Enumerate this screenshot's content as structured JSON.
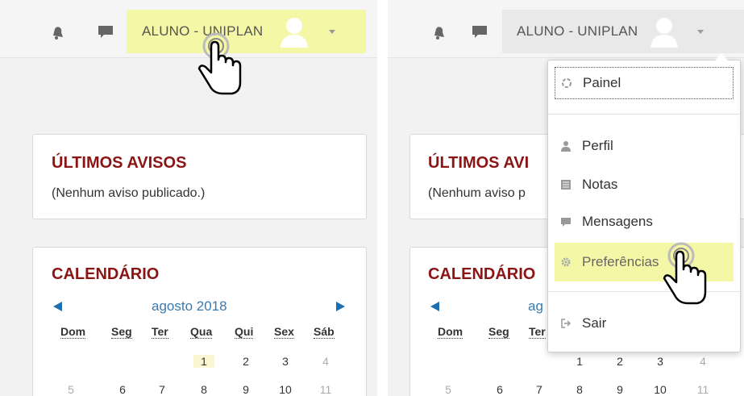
{
  "left": {
    "navbar": {
      "user_name": "ALUNO - UNIPLAN",
      "notification_icon": "bell-icon",
      "messages_icon": "speech-bubble-icon"
    },
    "notices": {
      "title": "ÚLTIMOS AVISOS",
      "text": "(Nenhum aviso publicado.)"
    },
    "calendar": {
      "title": "CALENDÁRIO",
      "month": "agosto 2018",
      "weekdays": [
        "Dom",
        "Seg",
        "Ter",
        "Qua",
        "Qui",
        "Sex",
        "Sáb"
      ],
      "row1": [
        "1",
        "2",
        "3",
        "4"
      ],
      "row2": [
        "5",
        "6",
        "7",
        "8",
        "9",
        "10",
        "11"
      ]
    }
  },
  "right": {
    "navbar": {
      "user_name": "ALUNO - UNIPLAN"
    },
    "notices": {
      "title": "ÚLTIMOS AVI",
      "text": "(Nenhum aviso p"
    },
    "calendar": {
      "title": "CALENDÁRIO",
      "month": "ag",
      "weekdays": [
        "Dom",
        "Seg",
        "Ter"
      ],
      "row1": [
        "1",
        "2",
        "3",
        "4"
      ],
      "row2": [
        "5",
        "6",
        "7",
        "8",
        "9",
        "10",
        "11"
      ]
    },
    "menu": {
      "painel": "Painel",
      "perfil": "Perfil",
      "notas": "Notas",
      "mensagens": "Mensagens",
      "preferencias": "Preferências",
      "sair": "Sair"
    }
  },
  "colors": {
    "highlight": "#f3f7a6",
    "title_red": "#8a1515",
    "link_blue": "#3a7ab0",
    "arrow_blue": "#1b6fb3"
  }
}
